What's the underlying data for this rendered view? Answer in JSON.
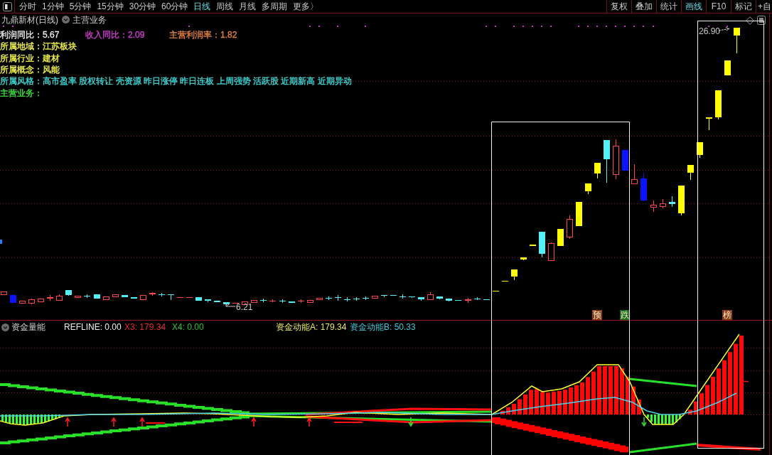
{
  "toolbar": {
    "periods": [
      {
        "label": "分时",
        "selected": false
      },
      {
        "label": "1分钟",
        "selected": false
      },
      {
        "label": "5分钟",
        "selected": false
      },
      {
        "label": "15分钟",
        "selected": false
      },
      {
        "label": "30分钟",
        "selected": false
      },
      {
        "label": "60分钟",
        "selected": false
      },
      {
        "label": "日线",
        "selected": true
      },
      {
        "label": "周线",
        "selected": false
      },
      {
        "label": "月线",
        "selected": false
      },
      {
        "label": "多周期",
        "selected": false
      },
      {
        "label": "更多〉",
        "selected": false
      }
    ],
    "tools": [
      {
        "label": "复权",
        "selected": false
      },
      {
        "label": "叠加",
        "selected": false
      },
      {
        "label": "统计",
        "selected": false
      },
      {
        "label": "画线",
        "selected": true
      },
      {
        "label": "F10",
        "selected": false
      },
      {
        "label": "标记",
        "selected": false
      },
      {
        "label": "+自",
        "selected": false
      }
    ]
  },
  "chart": {
    "title": "九鼎新材(日线)",
    "dropdown_label": "主营业务",
    "info_rows": [
      {
        "items": [
          {
            "text": "利润同比：5.67",
            "color": "#e8e8e8"
          },
          {
            "text": "收入同比：2.09",
            "color": "#d040d0"
          },
          {
            "text": "主营利润率：1.82",
            "color": "#e08040"
          }
        ]
      },
      {
        "items": [
          {
            "text": "所属地域：江苏板块",
            "color": "#f0f050"
          }
        ]
      },
      {
        "items": [
          {
            "text": "所属行业：建材",
            "color": "#f0f050"
          }
        ]
      },
      {
        "items": [
          {
            "text": "所属概念：风能",
            "color": "#f0f050"
          }
        ]
      },
      {
        "items": [
          {
            "text": "所属风格：高市盈率 股权转让 壳资源 昨日涨停 昨日连板 上周强势 活跃股 近期新高 近期异动",
            "color": "#40d8d8"
          }
        ]
      },
      {
        "items": [
          {
            "text": "主营业务：",
            "color": "#40e040"
          }
        ]
      }
    ],
    "high_price": "26.90",
    "low_price": "6.21",
    "signals": [
      {
        "label": "预",
        "color": "#8a3c18"
      },
      {
        "label": "跌",
        "color": "#1c6e1c"
      },
      {
        "label": "榜",
        "color": "#8a3c18"
      }
    ]
  },
  "indicator": {
    "name": "资金量能",
    "readouts": [
      {
        "text": "REFLINE: 0.00",
        "color": "#f0f0f0"
      },
      {
        "text": "X3: 179.34",
        "color": "#e03030"
      },
      {
        "text": "X4: 0.00",
        "color": "#30c030"
      },
      {
        "text": "资金动能A: 179.34",
        "color": "#e8e860"
      },
      {
        "text": "资金动能B: 50.33",
        "color": "#40c8d8"
      }
    ]
  }
}
